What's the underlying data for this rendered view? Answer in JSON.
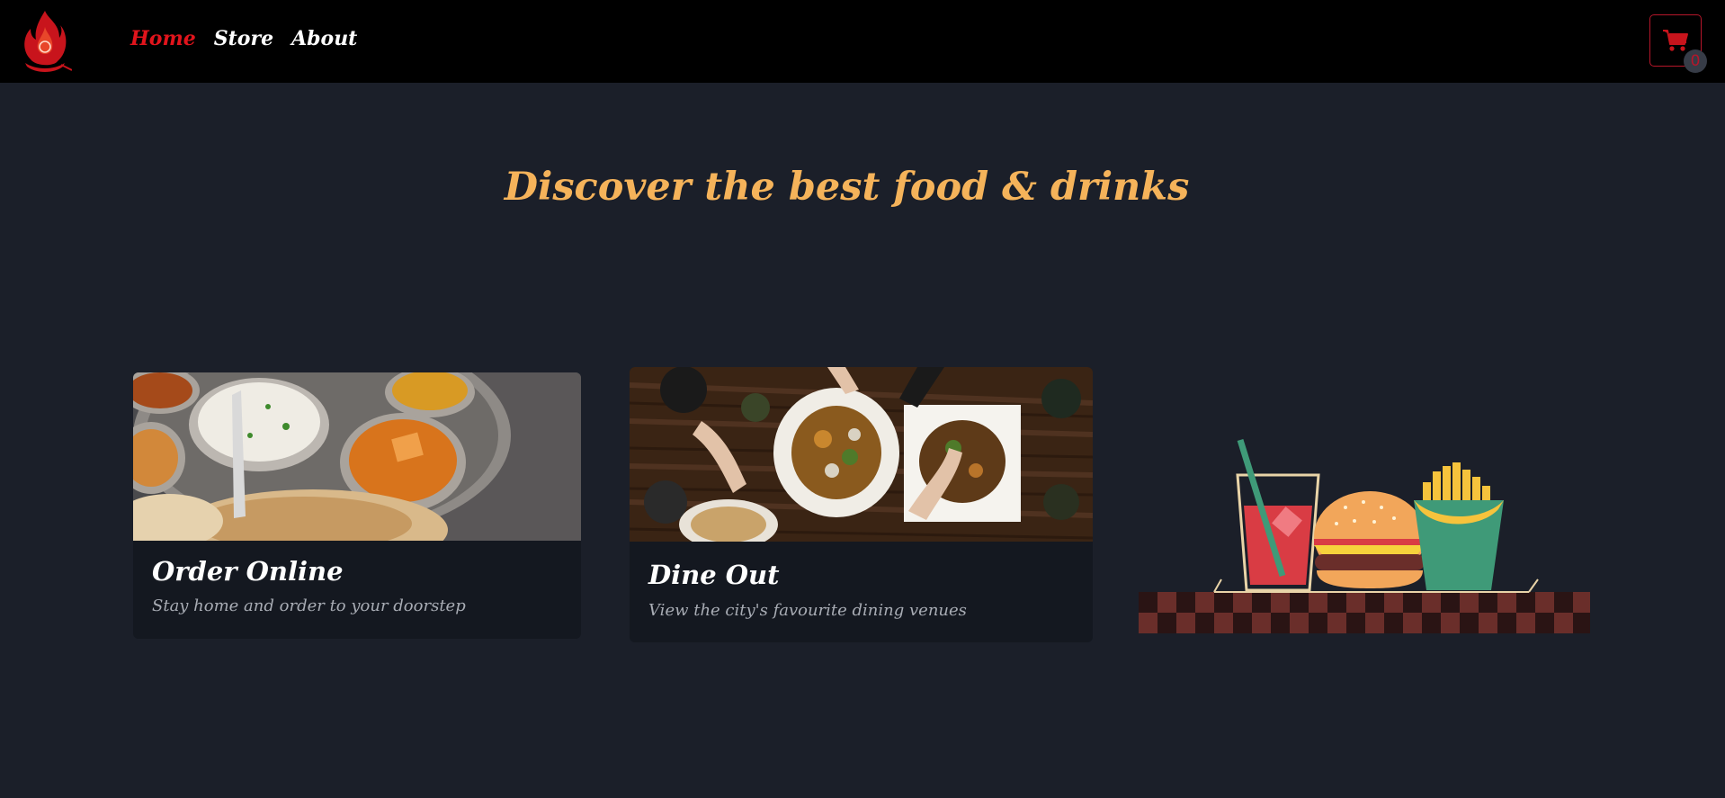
{
  "nav": {
    "logo": "flame-chef-logo",
    "links": [
      {
        "label": "Home",
        "active": true
      },
      {
        "label": "Store",
        "active": false
      },
      {
        "label": "About",
        "active": false
      }
    ],
    "cart": {
      "icon": "cart-icon",
      "count": "0"
    }
  },
  "hero": {
    "title": "Discover the best food & drinks"
  },
  "cards": [
    {
      "title": "Order Online",
      "subtitle": "Stay home and order to your doorstep",
      "image": "indian-thali-photo"
    },
    {
      "title": "Dine Out",
      "subtitle": "View the city's favourite dining venues",
      "image": "restaurant-table-photo"
    }
  ],
  "illustration": "drink-burger-fries-illustration",
  "colors": {
    "background": "#1b1f29",
    "navbar": "#000000",
    "accent_red": "#e1141c",
    "title_orange": "#f5b35a",
    "card_background": "#141820"
  }
}
